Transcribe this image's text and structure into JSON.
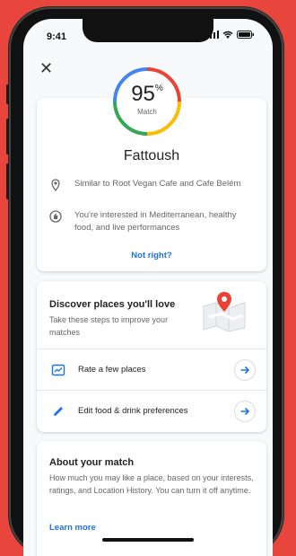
{
  "status": {
    "time": "9:41"
  },
  "match": {
    "percent": "95",
    "percent_symbol": "%",
    "label": "Match",
    "ring_colors": [
      "#4285f4",
      "#34a853",
      "#fbbc05",
      "#ea4335"
    ]
  },
  "place": {
    "name": "Fattoush",
    "reasons": [
      {
        "icon": "location-pin-icon",
        "text": "Similar to Root Vegan Cafe and Cafe Belém"
      },
      {
        "icon": "thumbs-up-circle-icon",
        "text": "You're interested in Mediterranean, healthy food, and live performances"
      }
    ],
    "not_right_label": "Not right?"
  },
  "discover": {
    "title": "Discover places you'll love",
    "subtitle": "Take these steps to improve your matches",
    "actions": [
      {
        "icon": "rate-places-icon",
        "label": "Rate a few places"
      },
      {
        "icon": "pencil-icon",
        "label": "Edit food & drink preferences"
      }
    ]
  },
  "about": {
    "title": "About your match",
    "body": "How much you may like a place, based on your interests, ratings, and Location History. You can turn it off anytime.",
    "learn_more_label": "Learn more"
  },
  "colors": {
    "background": "#e8453c",
    "accent_blue": "#1a73e8",
    "pin_red": "#ea4335"
  }
}
